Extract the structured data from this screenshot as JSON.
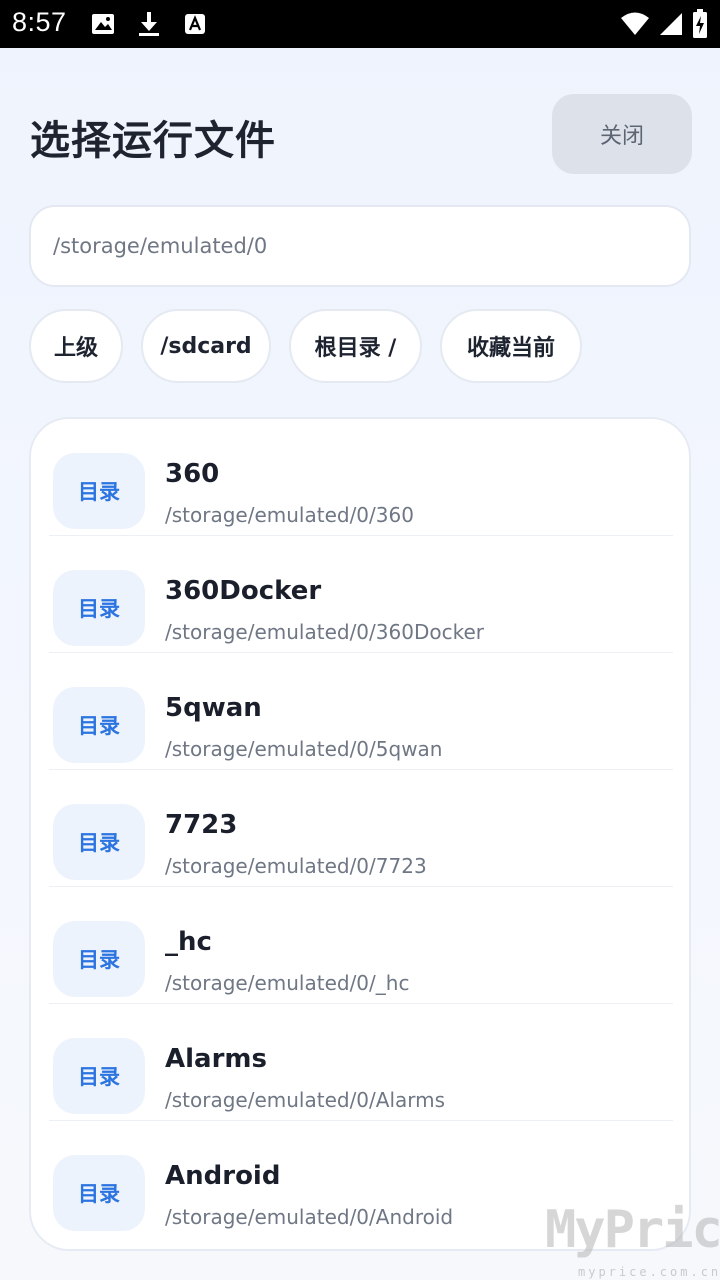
{
  "status_bar": {
    "time": "8:57",
    "left_icons": [
      "image-icon",
      "download-icon",
      "font-icon"
    ],
    "right_icons": [
      "wifi-icon",
      "signal-icon",
      "battery-charging-icon"
    ]
  },
  "header": {
    "title": "选择运行文件",
    "close_label": "关闭"
  },
  "path_field": {
    "value": "/storage/emulated/0"
  },
  "quick_buttons": [
    {
      "label": "上级"
    },
    {
      "label": "/sdcard"
    },
    {
      "label": "根目录 /"
    },
    {
      "label": "收藏当前"
    }
  ],
  "entries": [
    {
      "badge": "目录",
      "name": "360",
      "path": "/storage/emulated/0/360"
    },
    {
      "badge": "目录",
      "name": "360Docker",
      "path": "/storage/emulated/0/360Docker"
    },
    {
      "badge": "目录",
      "name": "5qwan",
      "path": "/storage/emulated/0/5qwan"
    },
    {
      "badge": "目录",
      "name": "7723",
      "path": "/storage/emulated/0/7723"
    },
    {
      "badge": "目录",
      "name": "_hc",
      "path": "/storage/emulated/0/_hc"
    },
    {
      "badge": "目录",
      "name": "Alarms",
      "path": "/storage/emulated/0/Alarms"
    },
    {
      "badge": "目录",
      "name": "Android",
      "path": "/storage/emulated/0/Android"
    }
  ],
  "watermark": {
    "text": "MyPrice",
    "sub": "myprice.com.cn"
  },
  "colors": {
    "accent": "#2c74e0",
    "badge_bg": "#edf3fd",
    "close_bg": "#dde2ea",
    "status_bar": "#000000"
  }
}
